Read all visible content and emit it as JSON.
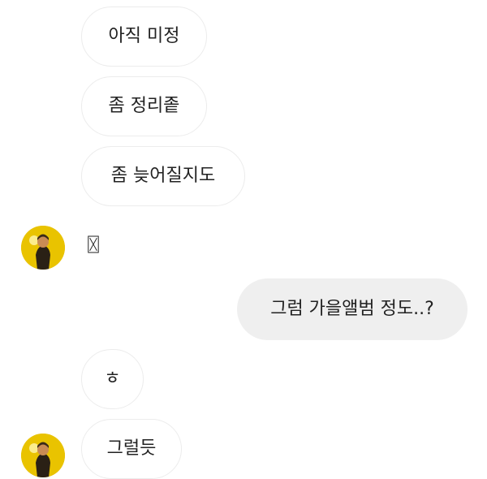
{
  "messages": [
    {
      "side": "in",
      "text": "아직 미정"
    },
    {
      "side": "in",
      "text": "좀 정리좉"
    },
    {
      "side": "in",
      "text": "좀 늦어질지도"
    },
    {
      "side": "in",
      "text": "〿"
    },
    {
      "side": "out",
      "text": "그럼 가을앨범 정도..?"
    },
    {
      "side": "in",
      "text": "ㅎ"
    },
    {
      "side": "in",
      "text": "그럴듯"
    }
  ],
  "colors": {
    "incoming_border": "#ececec",
    "outgoing_bg": "#efefef",
    "avatar": "#e8c000"
  },
  "icons": [
    "avatar-icon"
  ]
}
